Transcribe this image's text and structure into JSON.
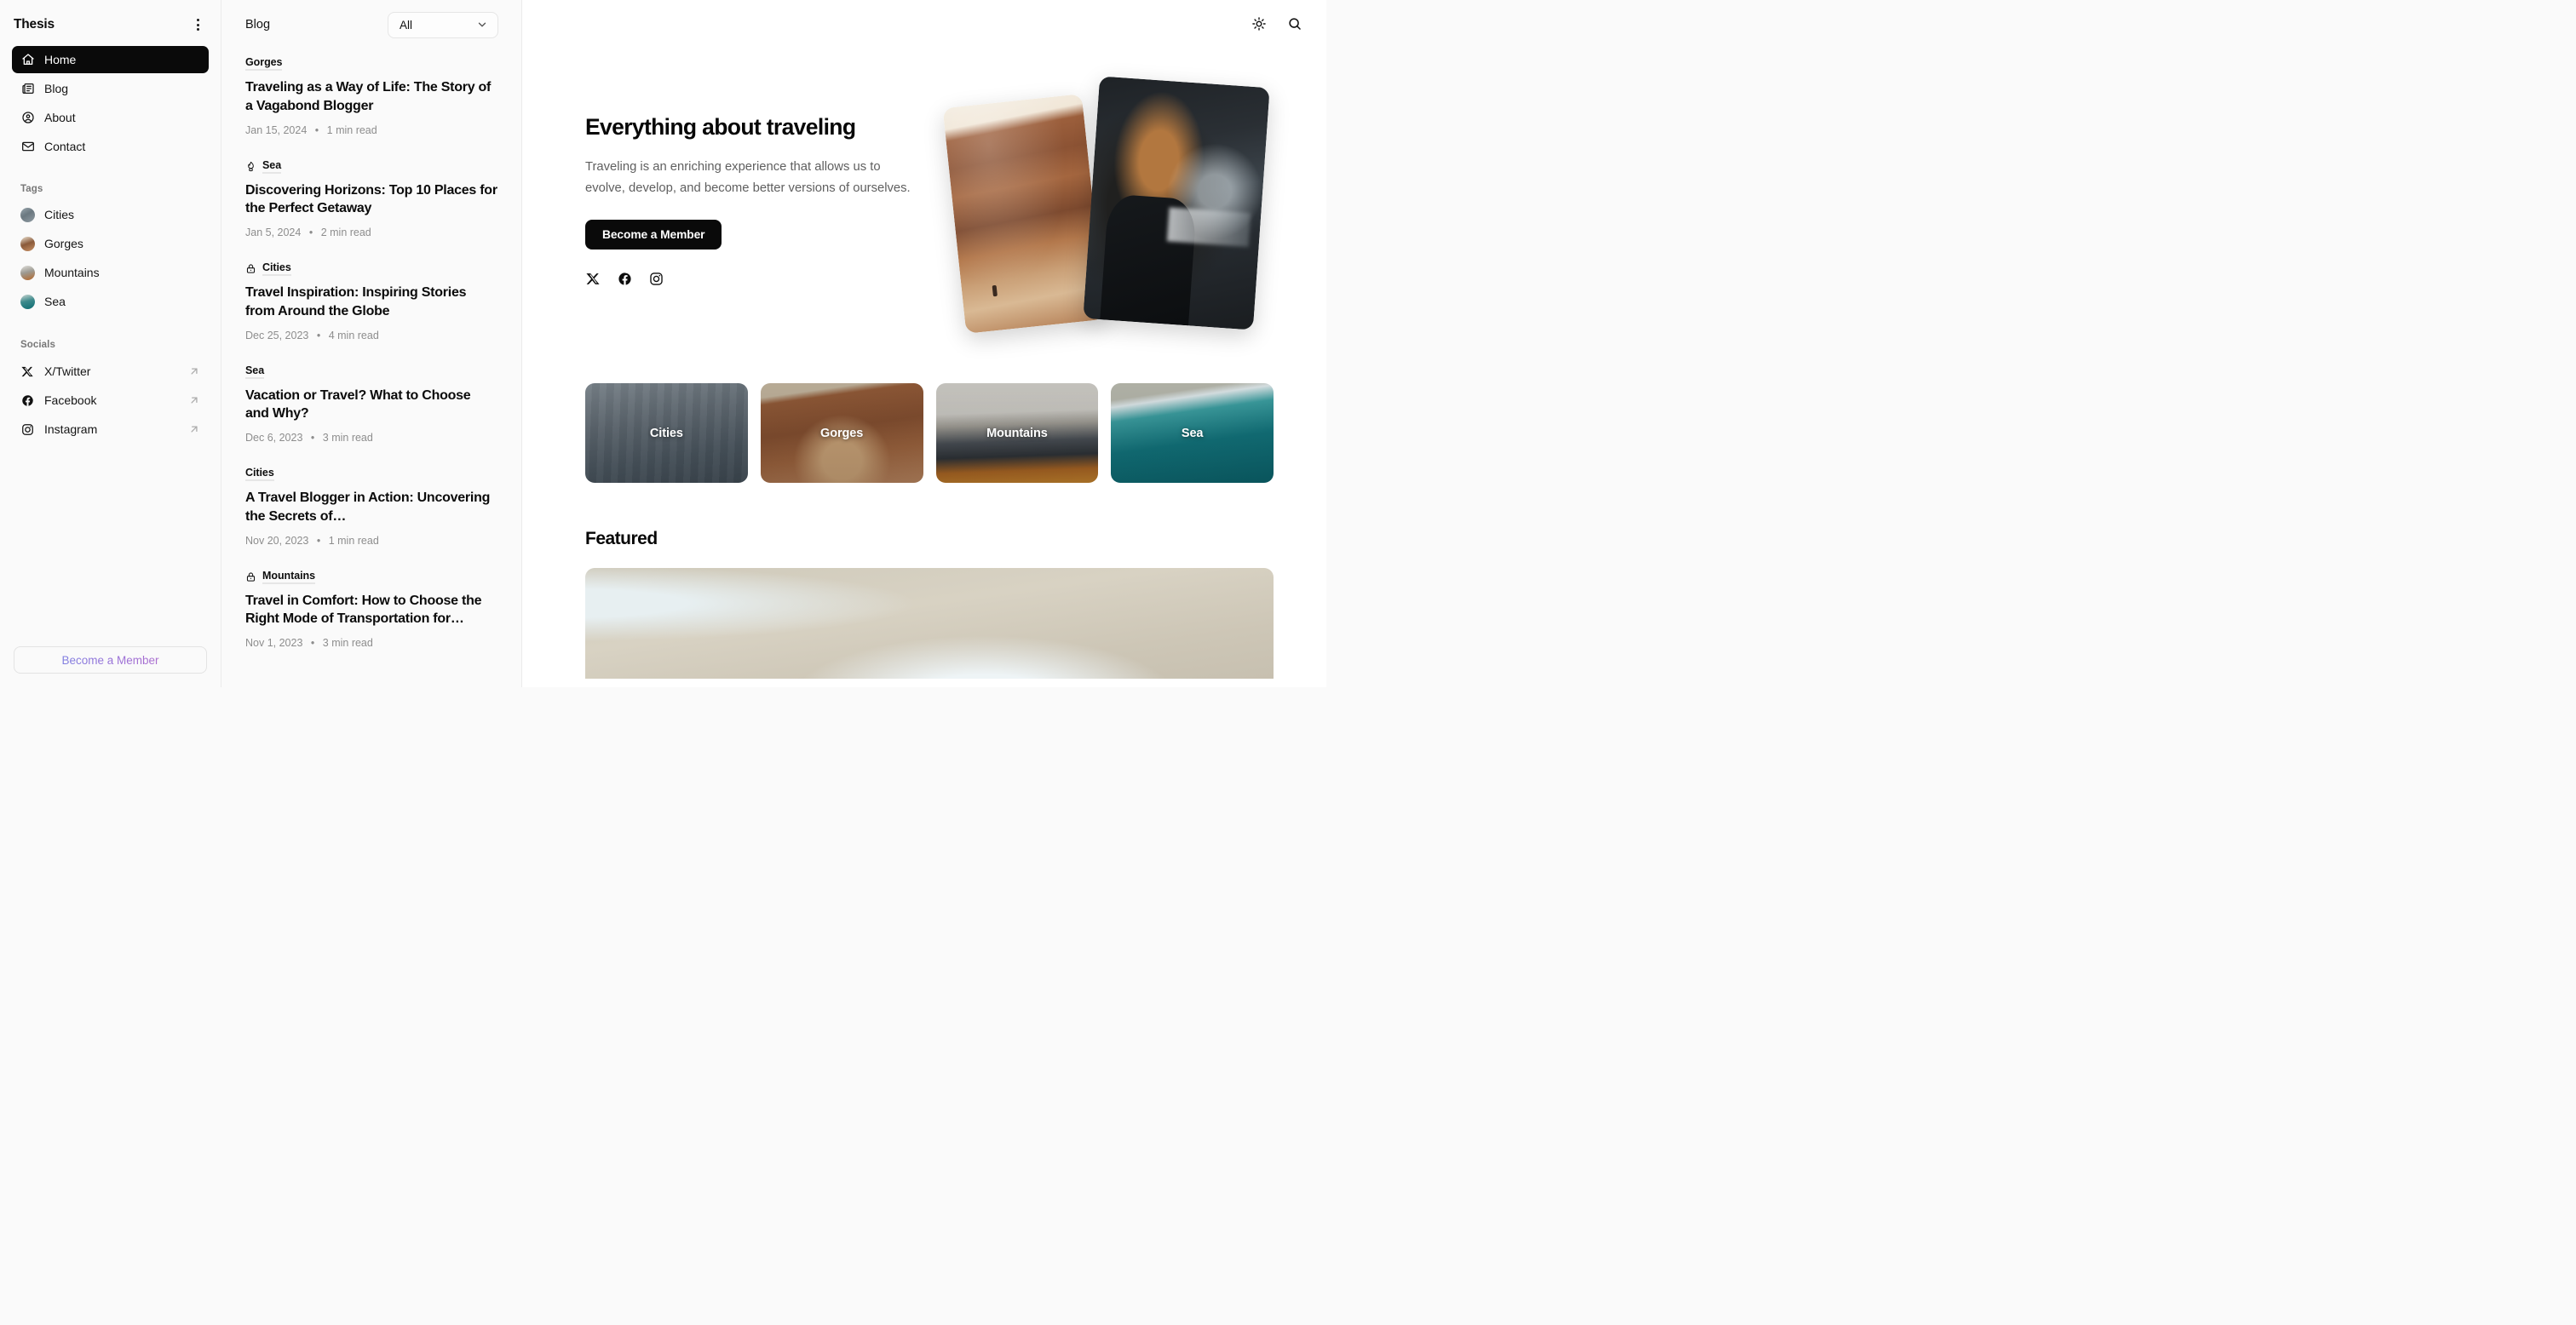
{
  "sidebar": {
    "brand": "Thesis",
    "menu_icon": "kebab-menu-icon",
    "nav": [
      {
        "label": "Home",
        "icon": "home-icon",
        "active": true
      },
      {
        "label": "Blog",
        "icon": "newspaper-icon",
        "active": false
      },
      {
        "label": "About",
        "icon": "user-circle-icon",
        "active": false
      },
      {
        "label": "Contact",
        "icon": "envelope-icon",
        "active": false
      }
    ],
    "tags_label": "Tags",
    "tags": [
      {
        "label": "Cities",
        "thumb": "cities-thumbnail"
      },
      {
        "label": "Gorges",
        "thumb": "gorges-thumbnail"
      },
      {
        "label": "Mountains",
        "thumb": "mountains-thumbnail"
      },
      {
        "label": "Sea",
        "thumb": "sea-thumbnail"
      }
    ],
    "socials_label": "Socials",
    "socials": [
      {
        "label": "X/Twitter",
        "icon": "x-twitter-icon"
      },
      {
        "label": "Facebook",
        "icon": "facebook-icon"
      },
      {
        "label": "Instagram",
        "icon": "instagram-icon"
      }
    ],
    "member_button": "Become a Member"
  },
  "list": {
    "title": "Blog",
    "filter_value": "All",
    "filter_icon": "chevron-down-icon",
    "posts": [
      {
        "category": "Gorges",
        "locked": false,
        "hot": false,
        "title": "Traveling as a Way of Life: The Story of a Vagabond Blogger",
        "date": "Jan 15, 2024",
        "read_time": "1 min read"
      },
      {
        "category": "Sea",
        "locked": false,
        "hot": true,
        "title": "Discovering Horizons: Top 10 Places for the Perfect Getaway",
        "date": "Jan 5, 2024",
        "read_time": "2 min read"
      },
      {
        "category": "Cities",
        "locked": true,
        "hot": false,
        "title": "Travel Inspiration: Inspiring Stories from Around the Globe",
        "date": "Dec 25, 2023",
        "read_time": "4 min read"
      },
      {
        "category": "Sea",
        "locked": false,
        "hot": false,
        "title": "Vacation or Travel? What to Choose and Why?",
        "date": "Dec 6, 2023",
        "read_time": "3 min read"
      },
      {
        "category": "Cities",
        "locked": false,
        "hot": false,
        "title": "A Travel Blogger in Action: Uncovering the Secrets of…",
        "date": "Nov 20, 2023",
        "read_time": "1 min read"
      },
      {
        "category": "Mountains",
        "locked": true,
        "hot": false,
        "title": "Travel in Comfort: How to Choose the Right Mode of Transportation for…",
        "date": "Nov 1, 2023",
        "read_time": "3 min read"
      }
    ],
    "meta_separator": "•"
  },
  "topbar": {
    "theme_icon": "sun-icon",
    "search_icon": "search-icon"
  },
  "hero": {
    "title": "Everything about traveling",
    "subtitle": "Traveling is an enriching experience that allows us to evolve, develop, and become better versions of ourselves.",
    "cta": "Become a Member",
    "socials": [
      {
        "icon": "x-twitter-icon"
      },
      {
        "icon": "facebook-icon"
      },
      {
        "icon": "instagram-icon"
      }
    ],
    "photos": [
      {
        "name": "gorge-canyon-photo"
      },
      {
        "name": "man-portrait-waterfall-photo"
      }
    ]
  },
  "categories": [
    {
      "label": "Cities"
    },
    {
      "label": "Gorges"
    },
    {
      "label": "Mountains"
    },
    {
      "label": "Sea"
    }
  ],
  "featured": {
    "heading": "Featured",
    "image_name": "featured-beach-photo"
  },
  "colors": {
    "accent_dark": "#0a0a0a",
    "page_bg": "#fafafa",
    "main_bg": "#ffffff",
    "border": "#ebebeb",
    "muted_text": "#8d8d8d",
    "member_gradient_start": "#6b8dea",
    "member_gradient_end": "#c06fc8"
  }
}
